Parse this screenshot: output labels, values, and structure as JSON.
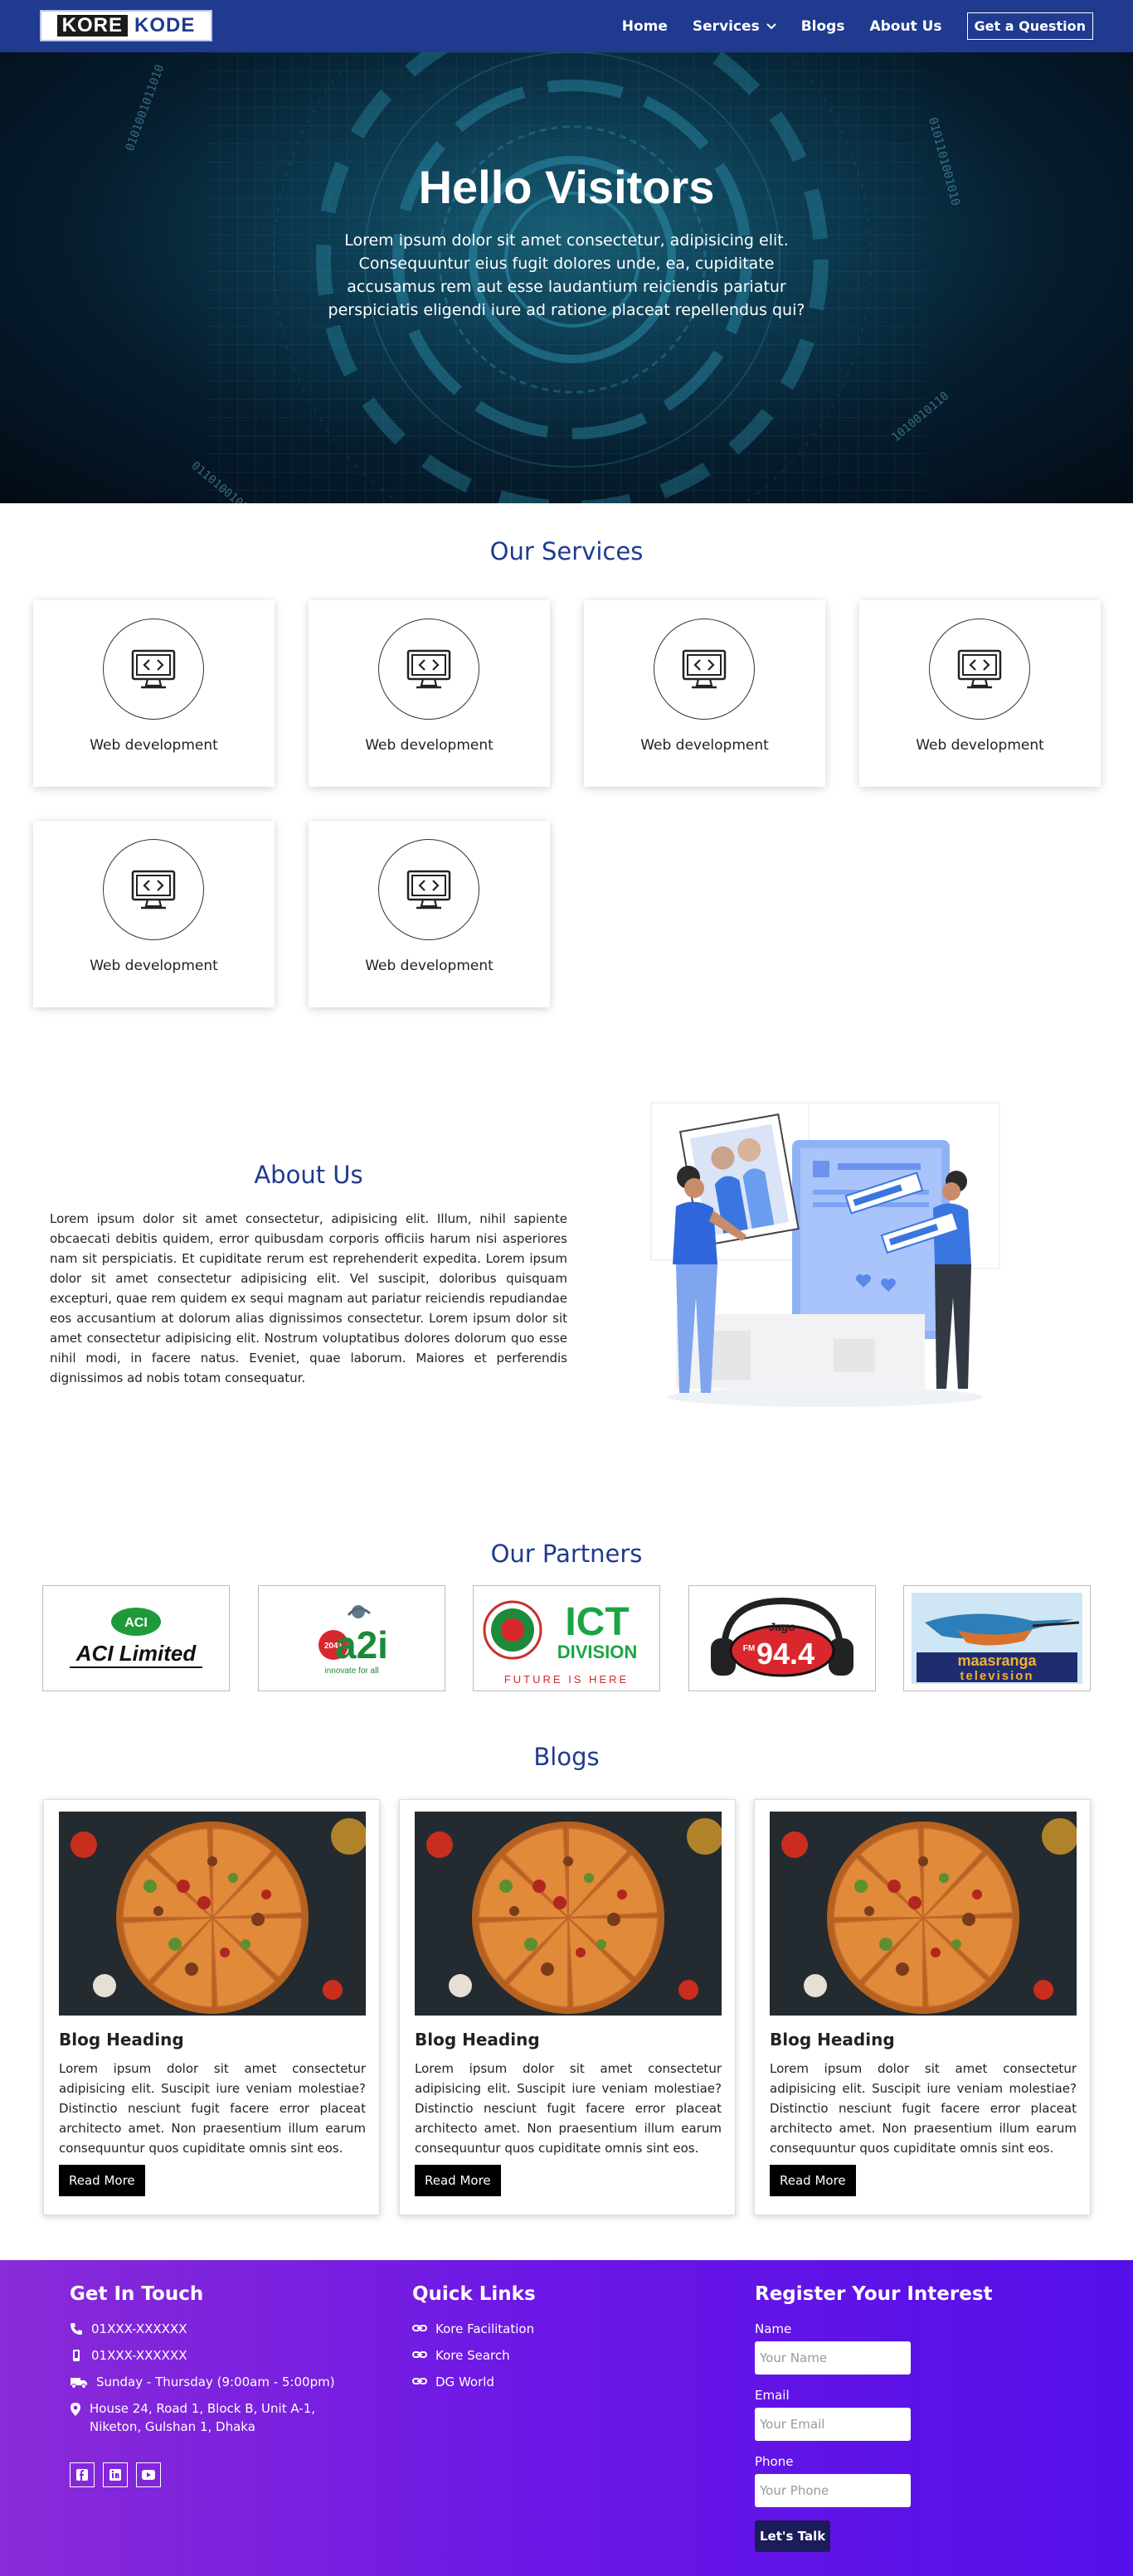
{
  "nav": {
    "logo_left": "KORE",
    "logo_right": "KODE",
    "items": [
      "Home",
      "Services",
      "Blogs",
      "About Us"
    ],
    "cta": "Get a Question"
  },
  "hero": {
    "title": "Hello Visitors",
    "text": "Lorem ipsum dolor sit amet consectetur, adipisicing elit. Consequuntur eius fugit dolores unde, ea, cupiditate accusamus rem aut esse laudantium reiciendis pariatur perspiciatis eligendi iure ad ratione placeat repellendus qui?"
  },
  "services": {
    "title": "Our Services",
    "items": [
      "Web development",
      "Web development",
      "Web development",
      "Web development",
      "Web development",
      "Web development"
    ]
  },
  "about": {
    "title": "About Us",
    "text": "Lorem ipsum dolor sit amet consectetur, adipisicing elit. Illum, nihil sapiente obcaecati debitis quidem, error quibusdam corporis officiis harum nisi asperiores nam sit perspiciatis. Et cupiditate rerum est reprehenderit expedita. Lorem ipsum dolor sit amet consectetur adipisicing elit. Vel suscipit, doloribus quisquam excepturi, quae rem quidem ex sequi magnam aut pariatur reiciendis repudiandae eos accusantium at dolorum alias dignissimos consectetur. Lorem ipsum dolor sit amet consectetur adipisicing elit. Nostrum voluptatibus dolores dolorum quo esse nihil modi, in facere natus. Eveniet, quae laborum. Maiores et perferendis dignissimos ad nobis totam consequatur."
  },
  "partners": {
    "title": "Our Partners",
    "logos": [
      {
        "name": "ACI Limited",
        "text": "ACI Limited",
        "badge": "ACI"
      },
      {
        "name": "a2i",
        "text": "a2i",
        "tag": "innovate for all",
        "year": "2041"
      },
      {
        "name": "ICT Division",
        "text": "ICT",
        "sub": "DIVISION",
        "tag": "FUTURE IS HERE"
      },
      {
        "name": "Jago FM 94.4",
        "text": "94.4",
        "brand": "Jago",
        "unit": "FM"
      },
      {
        "name": "Maasranga Television",
        "text": "maasranga",
        "sub": "television"
      }
    ]
  },
  "blogs": {
    "title": "Blogs",
    "items": [
      {
        "heading": "Blog Heading",
        "text": "Lorem ipsum dolor sit amet consectetur adipisicing elit. Suscipit iure veniam molestiae? Distinctio nesciunt fugit facere error placeat architecto amet. Non praesentium illum earum consequuntur quos cupiditate omnis sint eos.",
        "button": "Read More"
      },
      {
        "heading": "Blog Heading",
        "text": "Lorem ipsum dolor sit amet consectetur adipisicing elit. Suscipit iure veniam molestiae? Distinctio nesciunt fugit facere error placeat architecto amet. Non praesentium illum earum consequuntur quos cupiditate omnis sint eos.",
        "button": "Read More"
      },
      {
        "heading": "Blog Heading",
        "text": "Lorem ipsum dolor sit amet consectetur adipisicing elit. Suscipit iure veniam molestiae? Distinctio nesciunt fugit facere error placeat architecto amet. Non praesentium illum earum consequuntur quos cupiditate omnis sint eos.",
        "button": "Read More"
      }
    ]
  },
  "footer": {
    "contact_title": "Get In Touch",
    "phone1": "01XXX-XXXXXX",
    "phone2": "01XXX-XXXXXX",
    "hours": "Sunday - Thursday (9:00am - 5:00pm)",
    "address": "House 24, Road 1, Block B, Unit A-1, Niketon, Gulshan 1, Dhaka",
    "links_title": "Quick Links",
    "links": [
      "Kore Facilitation",
      "Kore Search",
      "DG World"
    ],
    "form_title": "Register Your Interest",
    "name_label": "Name",
    "name_placeholder": "Your Name",
    "email_label": "Email",
    "email_placeholder": "Your Email",
    "phone_label": "Phone",
    "phone_placeholder": "Your Phone",
    "submit": "Let's Talk"
  },
  "colors": {
    "nav": "#1f3a8f",
    "heading": "#1f3a8f",
    "footer_start": "#8a2bd8",
    "footer_end": "#5410e8"
  }
}
